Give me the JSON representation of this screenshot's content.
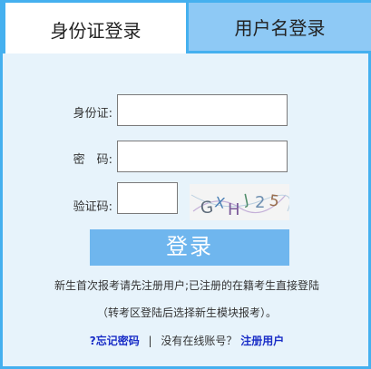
{
  "tabs": {
    "id_login": "身份证登录",
    "username_login": "用户名登录"
  },
  "form": {
    "id_label": "身份证:",
    "password_label": "密　码:",
    "captcha_label": "验证码:",
    "id_value": "",
    "password_value": "",
    "captcha_value": "",
    "captcha_text": "GXHJ25"
  },
  "login_button": "登录",
  "notes": {
    "line1": "新生首次报考请先注册用户;已注册的在籍考生直接登陆",
    "line2": "（转考区登陆后选择新生模块报考）。"
  },
  "links": {
    "forgot_password": "?忘记密码",
    "separator": "|",
    "no_account": "没有在线账号？",
    "register": "注册用户"
  },
  "colors": {
    "border": "#45b0ef",
    "panel_bg": "#e7f3fb",
    "inactive_tab": "#8ec9f5",
    "button": "#6fb6ee",
    "link": "#1a2ec7"
  }
}
